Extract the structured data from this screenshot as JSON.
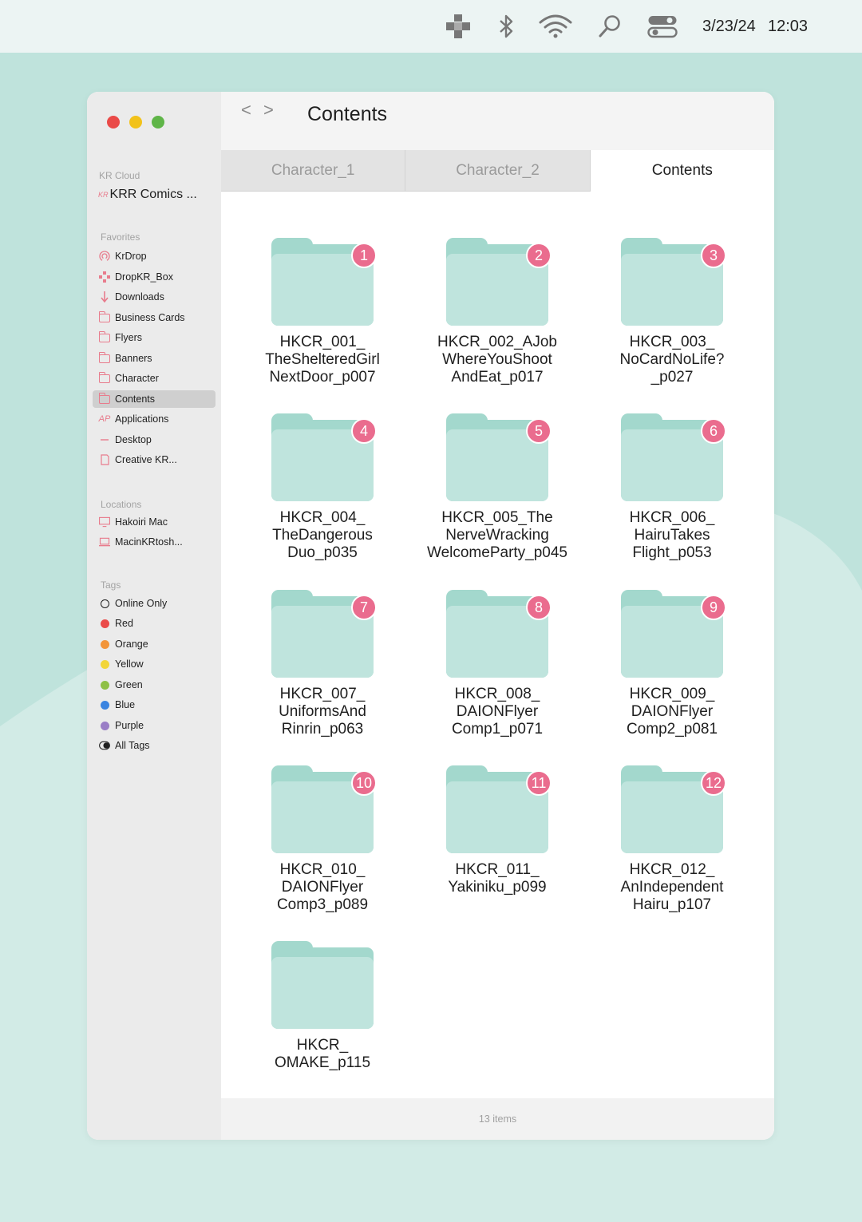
{
  "colors": {
    "background": "#bfe3dc",
    "menubar": "#ecf4f3",
    "folder": "#bfe4dd",
    "badge": "#ea6c8e",
    "accent_icon": "#e87b8c"
  },
  "menubar": {
    "icons": [
      "cross-grid-icon",
      "bluetooth-icon",
      "wifi-icon",
      "search-icon",
      "control-center-icon"
    ],
    "date": "3/23/24",
    "time": "12:03"
  },
  "sidebar": {
    "cloud_label": "KR Cloud",
    "cloud_logo": "KR",
    "cloud_name": "KRR Comics ...",
    "favorites_label": "Favorites",
    "favorites": [
      {
        "label": "KrDrop",
        "icon": "airdrop-icon"
      },
      {
        "label": "DropKR_Box",
        "icon": "dropbox-icon"
      },
      {
        "label": "Downloads",
        "icon": "download-arrow-icon"
      },
      {
        "label": "Business Cards",
        "icon": "folder-icon"
      },
      {
        "label": "Flyers",
        "icon": "folder-icon"
      },
      {
        "label": "Banners",
        "icon": "folder-icon"
      },
      {
        "label": "Character",
        "icon": "folder-icon"
      },
      {
        "label": "Contents",
        "icon": "folder-icon",
        "active": true
      },
      {
        "label": "Applications",
        "icon": "applications-icon"
      },
      {
        "label": "Desktop",
        "icon": "desktop-icon"
      },
      {
        "label": "Creative KR...",
        "icon": "document-icon"
      }
    ],
    "locations_label": "Locations",
    "locations": [
      {
        "label": "Hakoiri Mac",
        "icon": "monitor-icon"
      },
      {
        "label": "MacinKRtosh...",
        "icon": "laptop-icon"
      }
    ],
    "tags_label": "Tags",
    "tags": [
      {
        "label": "Online Only",
        "color": "ring"
      },
      {
        "label": "Red",
        "color": "#ea4a48"
      },
      {
        "label": "Orange",
        "color": "#f2953a"
      },
      {
        "label": "Yellow",
        "color": "#f2d53a"
      },
      {
        "label": "Green",
        "color": "#8fc045"
      },
      {
        "label": "Blue",
        "color": "#3a84e0"
      },
      {
        "label": "Purple",
        "color": "#9a7ec6"
      },
      {
        "label": "All Tags",
        "color": "toggle"
      }
    ]
  },
  "toolbar": {
    "back": "<",
    "forward": ">",
    "title": "Contents"
  },
  "tabs": [
    {
      "label": "Character_1",
      "active": false
    },
    {
      "label": "Character_2",
      "active": false
    },
    {
      "label": "Contents",
      "active": true
    }
  ],
  "folders": [
    {
      "badge": "1",
      "lines": [
        "HKCR_001_",
        "TheShelteredGirl",
        "NextDoor_p007"
      ]
    },
    {
      "badge": "2",
      "lines": [
        "HKCR_002_AJob",
        "WhereYouShoot",
        "AndEat_p017"
      ]
    },
    {
      "badge": "3",
      "lines": [
        "HKCR_003_",
        "NoCardNoLife?",
        "_p027"
      ]
    },
    {
      "badge": "4",
      "lines": [
        "HKCR_004_",
        "TheDangerous",
        "Duo_p035"
      ]
    },
    {
      "badge": "5",
      "lines": [
        "HKCR_005_The",
        "NerveWracking",
        "WelcomeParty_p045"
      ]
    },
    {
      "badge": "6",
      "lines": [
        "HKCR_006_",
        "HairuTakes",
        "Flight_p053"
      ]
    },
    {
      "badge": "7",
      "lines": [
        "HKCR_007_",
        "UniformsAnd",
        "Rinrin_p063"
      ]
    },
    {
      "badge": "8",
      "lines": [
        "HKCR_008_",
        "DAIONFlyer",
        "Comp1_p071"
      ]
    },
    {
      "badge": "9",
      "lines": [
        "HKCR_009_",
        "DAIONFlyer",
        "Comp2_p081"
      ]
    },
    {
      "badge": "10",
      "lines": [
        "HKCR_010_",
        "DAIONFlyer",
        "Comp3_p089"
      ]
    },
    {
      "badge": "11",
      "lines": [
        "HKCR_011_",
        "Yakiniku_p099"
      ]
    },
    {
      "badge": "12",
      "lines": [
        "HKCR_012_",
        "AnIndependent",
        "Hairu_p107"
      ]
    },
    {
      "badge": "",
      "lines": [
        "HKCR_",
        "OMAKE_p115"
      ]
    }
  ],
  "status": {
    "items_count": "13 items"
  }
}
